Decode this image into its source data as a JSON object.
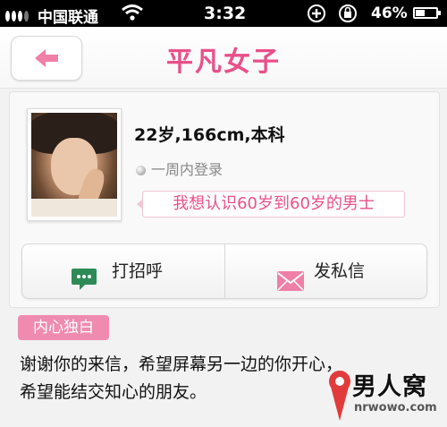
{
  "status_bar": {
    "carrier": "中国联通",
    "time": "3:32",
    "battery_percent": "46%",
    "battery_level": 0.46
  },
  "nav": {
    "title": "平凡女子",
    "back_icon": "arrow-left-icon"
  },
  "profile": {
    "info": "22岁,166cm,本科",
    "online_status": "一周内登录",
    "seeking": "我想认识60岁到60岁的男士"
  },
  "actions": {
    "greet_label": "打招呼",
    "greet_icon": "chat-bubble-icon",
    "message_label": "发私信",
    "message_icon": "envelope-icon"
  },
  "monologue": {
    "tag": "内心独白",
    "lines": [
      "谢谢你的来信，希望屏幕另一边的你开心，",
      "希望能结交知心的朋友。"
    ]
  },
  "watermark": {
    "text": "男人窝",
    "url": "nrwowo.com"
  },
  "colors": {
    "accent_pink": "#e9508a",
    "tag_pink": "#f08bb0",
    "greet_green": "#2e8b57",
    "message_pink": "#ef7fa7"
  }
}
